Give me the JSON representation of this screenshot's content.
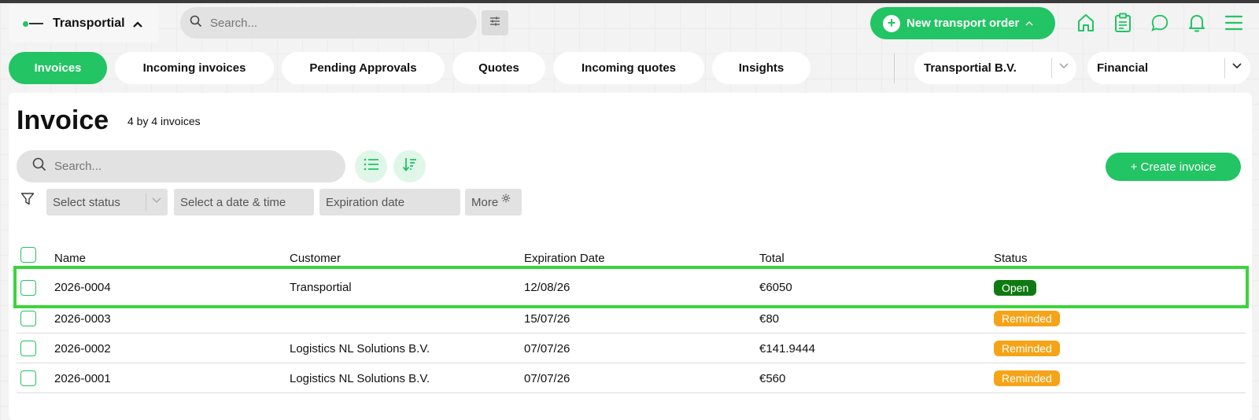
{
  "brand": {
    "name": "Transportial"
  },
  "top_search": {
    "placeholder": "Search..."
  },
  "new_order": {
    "label": "New transport order"
  },
  "tabs": [
    {
      "label": "Invoices",
      "active": true
    },
    {
      "label": "Incoming invoices",
      "active": false
    },
    {
      "label": "Pending Approvals",
      "active": false
    },
    {
      "label": "Quotes",
      "active": false
    },
    {
      "label": "Incoming quotes",
      "active": false
    },
    {
      "label": "Insights",
      "active": false
    }
  ],
  "company_select": {
    "value": "Transportial B.V."
  },
  "section_select": {
    "value": "Financial"
  },
  "page": {
    "title": "Invoice",
    "count": "4 by 4 invoices"
  },
  "list_search": {
    "placeholder": "Search..."
  },
  "create_button": {
    "label": "+ Create invoice"
  },
  "filters": {
    "status_placeholder": "Select status",
    "date_placeholder": "Select a date & time",
    "expiration_placeholder": "Expiration date",
    "more_label": "More"
  },
  "table": {
    "columns": [
      "Name",
      "Customer",
      "Expiration Date",
      "Total",
      "Status"
    ],
    "rows": [
      {
        "name": "2026-0004",
        "customer": "Transportial",
        "expiration": "12/08/26",
        "total": "€6050",
        "status": "Open",
        "status_color": "#0f7a12"
      },
      {
        "name": "2026-0003",
        "customer": "",
        "expiration": "15/07/26",
        "total": "€80",
        "status": "Reminded",
        "status_color": "#f5a418"
      },
      {
        "name": "2026-0002",
        "customer": "Logistics NL Solutions B.V.",
        "expiration": "07/07/26",
        "total": "€141.9444",
        "status": "Reminded",
        "status_color": "#f5a418"
      },
      {
        "name": "2026-0001",
        "customer": "Logistics NL Solutions B.V.",
        "expiration": "07/07/26",
        "total": "€560",
        "status": "Reminded",
        "status_color": "#f5a418"
      }
    ]
  },
  "colors": {
    "accent": "#22c463",
    "highlight": "#3bd43b"
  },
  "icons": [
    "search-icon",
    "sliders-icon",
    "plus-icon",
    "home-icon",
    "clipboard-icon",
    "chat-icon",
    "bell-icon",
    "menu-icon",
    "list-icon",
    "sort-icon",
    "funnel-icon",
    "gear-icon",
    "chevron-down-icon"
  ]
}
